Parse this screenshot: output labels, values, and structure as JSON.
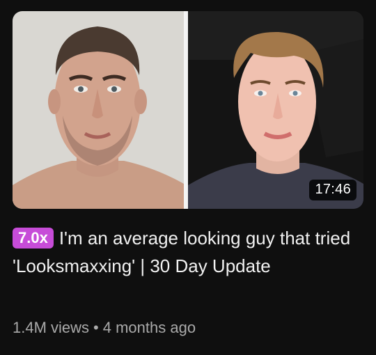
{
  "video": {
    "duration": "17:46",
    "speed_badge": "7.0x",
    "title": "I'm an average looking guy that tried 'Looksmaxxing' | 30 Day Update",
    "views": "1.4M views",
    "separator": "•",
    "age": "4 months ago"
  },
  "colors": {
    "background": "#0f0f0f",
    "badge": "#c74cd8",
    "meta_text": "#aaaaaa"
  }
}
